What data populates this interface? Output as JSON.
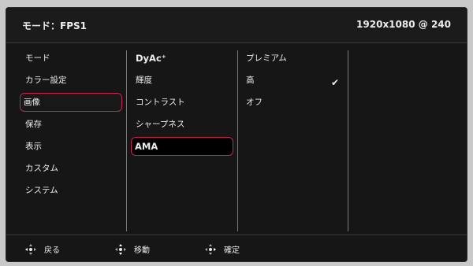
{
  "header": {
    "mode_label": "モード：FPS1",
    "resolution": "1920x1080 @ 240"
  },
  "menu": {
    "col1": [
      "モード",
      "カラー設定",
      "画像",
      "保存",
      "表示",
      "カスタム",
      "システム"
    ],
    "col2": [
      "DyAc⁺",
      "輝度",
      "コントラスト",
      "シャープネス",
      "AMA"
    ],
    "col3": [
      "プレミアム",
      "高",
      "オフ"
    ],
    "selected_col1": "画像",
    "highlighted_col2": "AMA",
    "checked_col3": "高",
    "check_glyph": "✔",
    "accent_color": "#c2274a"
  },
  "footer": {
    "back": "戻る",
    "move": "移動",
    "confirm": "確定"
  }
}
